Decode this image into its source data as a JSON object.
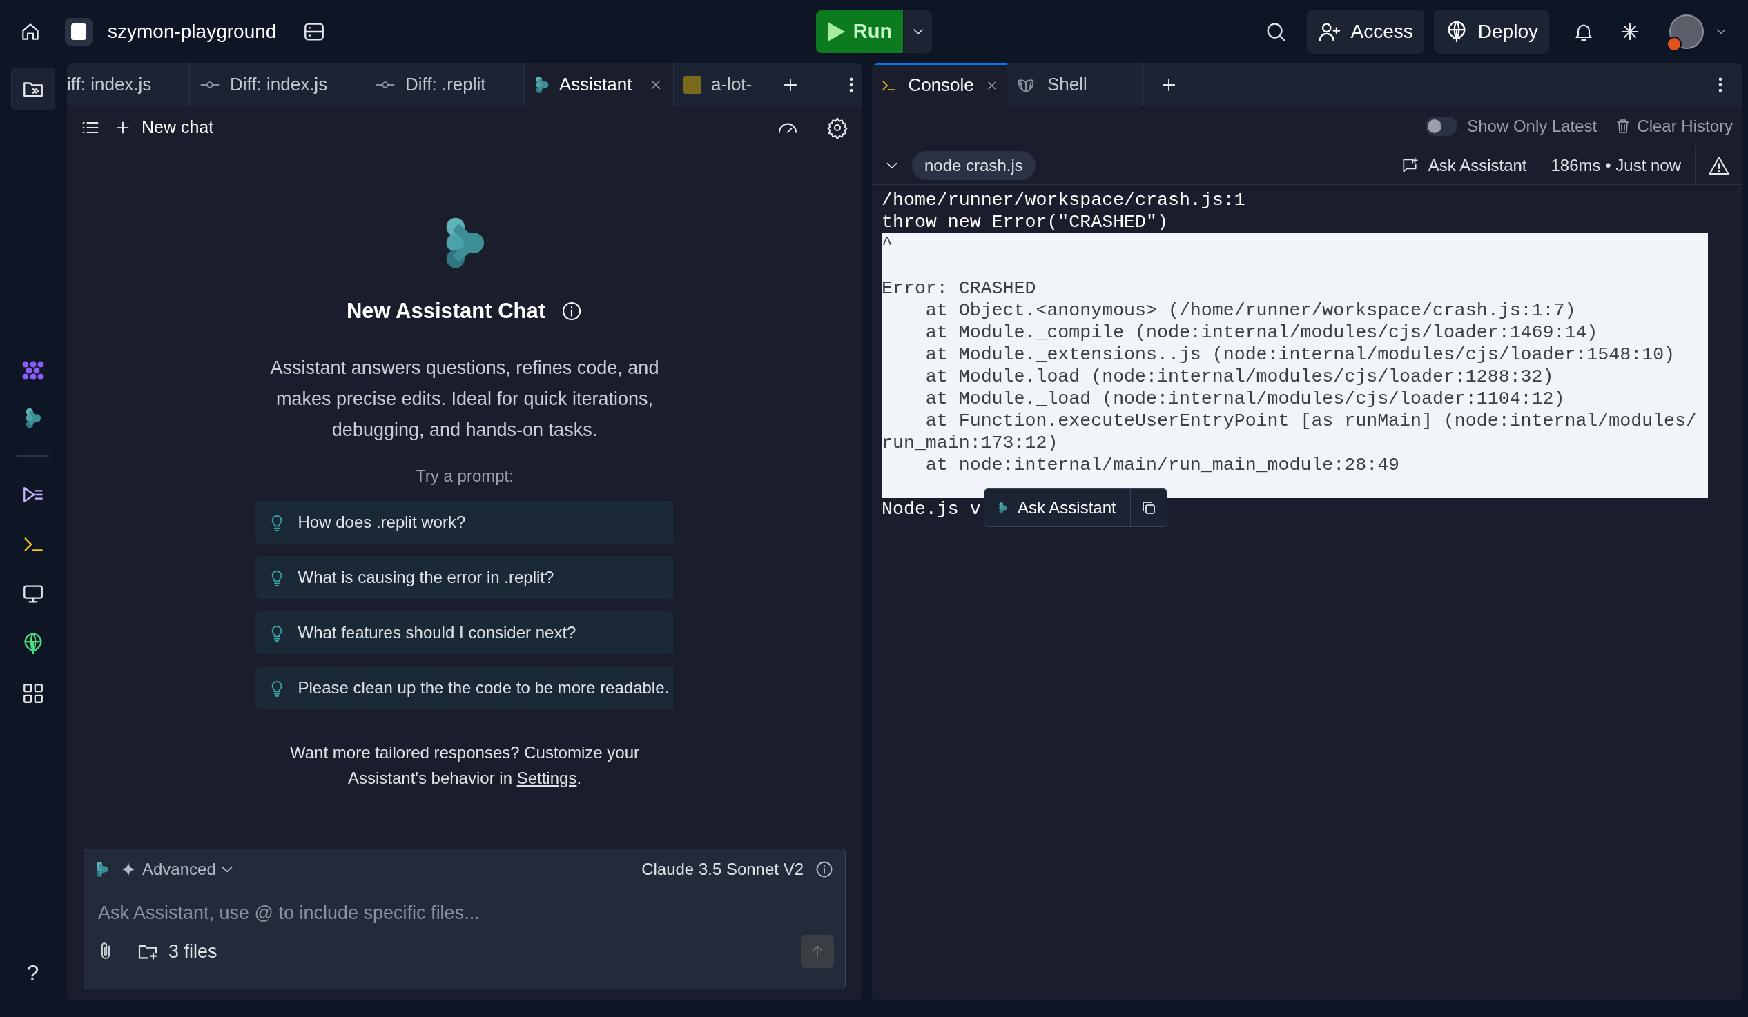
{
  "topbar": {
    "project": "szymon-playground",
    "run": "Run",
    "buttons": [
      {
        "label": "Access",
        "kind": "access"
      },
      {
        "label": "Deploy",
        "kind": "deploy"
      }
    ]
  },
  "rail": {
    "help": "?"
  },
  "left_pane": {
    "tabs": [
      {
        "label": "iff: index.js",
        "kind": "plain",
        "selected": false
      },
      {
        "label": "Diff: index.js",
        "kind": "diff",
        "selected": false
      },
      {
        "label": "Diff: .replit",
        "kind": "diff",
        "selected": false
      },
      {
        "label": "Assistant",
        "kind": "assistant",
        "selected": true
      },
      {
        "label": "a-lot-",
        "kind": "js",
        "selected": false
      }
    ],
    "new_chat": "New chat",
    "assistant": {
      "title": "New Assistant Chat",
      "description": "Assistant answers questions, refines code, and makes precise edits. Ideal for quick iterations, debugging, and hands-on tasks.",
      "try_label": "Try a prompt:",
      "prompts": [
        "How does .replit work?",
        "What is causing the error in .replit?",
        "What features should I consider next?",
        "Please clean up the the code to be more readable."
      ],
      "footer": "Want more tailored responses? Customize your Assistant's behavior in ",
      "footer_link": "Settings",
      "footer_end": "."
    },
    "composer": {
      "mode": "Advanced",
      "model": "Claude 3.5 Sonnet V2",
      "placeholder": "Ask Assistant, use @ to include specific files...",
      "files": "3 files"
    }
  },
  "right_pane": {
    "tabs": [
      {
        "label": "Console",
        "kind": "console",
        "selected": true
      },
      {
        "label": "Shell",
        "kind": "shell",
        "selected": false
      }
    ],
    "show_only_latest": {
      "label": "Show Only Latest",
      "on": false
    },
    "clear_history": "Clear History",
    "run": {
      "command": "node crash.js",
      "ask": "Ask Assistant",
      "timing": "186ms • Just now",
      "expanded": true
    },
    "output": [
      {
        "kind": "text",
        "text": "/home/runner/workspace/crash.js:1",
        "selected": false
      },
      {
        "kind": "text",
        "text": "throw new Error(\"CRASHED\")",
        "selected": false
      },
      {
        "kind": "text",
        "text": "^",
        "selected": true
      },
      {
        "kind": "blank",
        "selected": true
      },
      {
        "kind": "text",
        "text": "Error: CRASHED",
        "selected": true
      },
      {
        "kind": "text",
        "text": "    at Object.<anonymous> (/home/runner/workspace/crash.js:1:7)",
        "selected": true
      },
      {
        "kind": "text",
        "text": "    at Module._compile (node:internal/modules/cjs/loader:1469:14)",
        "selected": true
      },
      {
        "kind": "text",
        "text": "    at Module._extensions..js (node:internal/modules/cjs/loader:1548:10)",
        "selected": true
      },
      {
        "kind": "text",
        "text": "    at Module.load (node:internal/modules/cjs/loader:1288:32)",
        "selected": true
      },
      {
        "kind": "text",
        "text": "    at Module._load (node:internal/modules/cjs/loader:1104:12)",
        "selected": true
      },
      {
        "kind": "text",
        "text": "    at Function.executeUserEntryPoint [as runMain] (node:internal/modules/run_main:173:12)",
        "selected": true
      },
      {
        "kind": "text",
        "text": "    at node:internal/main/run_main_module:28:49",
        "selected": true
      },
      {
        "kind": "blank",
        "selected": true
      },
      {
        "kind": "text",
        "text": "Node.js v",
        "selected": false
      }
    ],
    "popup": {
      "label": "Ask Assistant"
    }
  }
}
